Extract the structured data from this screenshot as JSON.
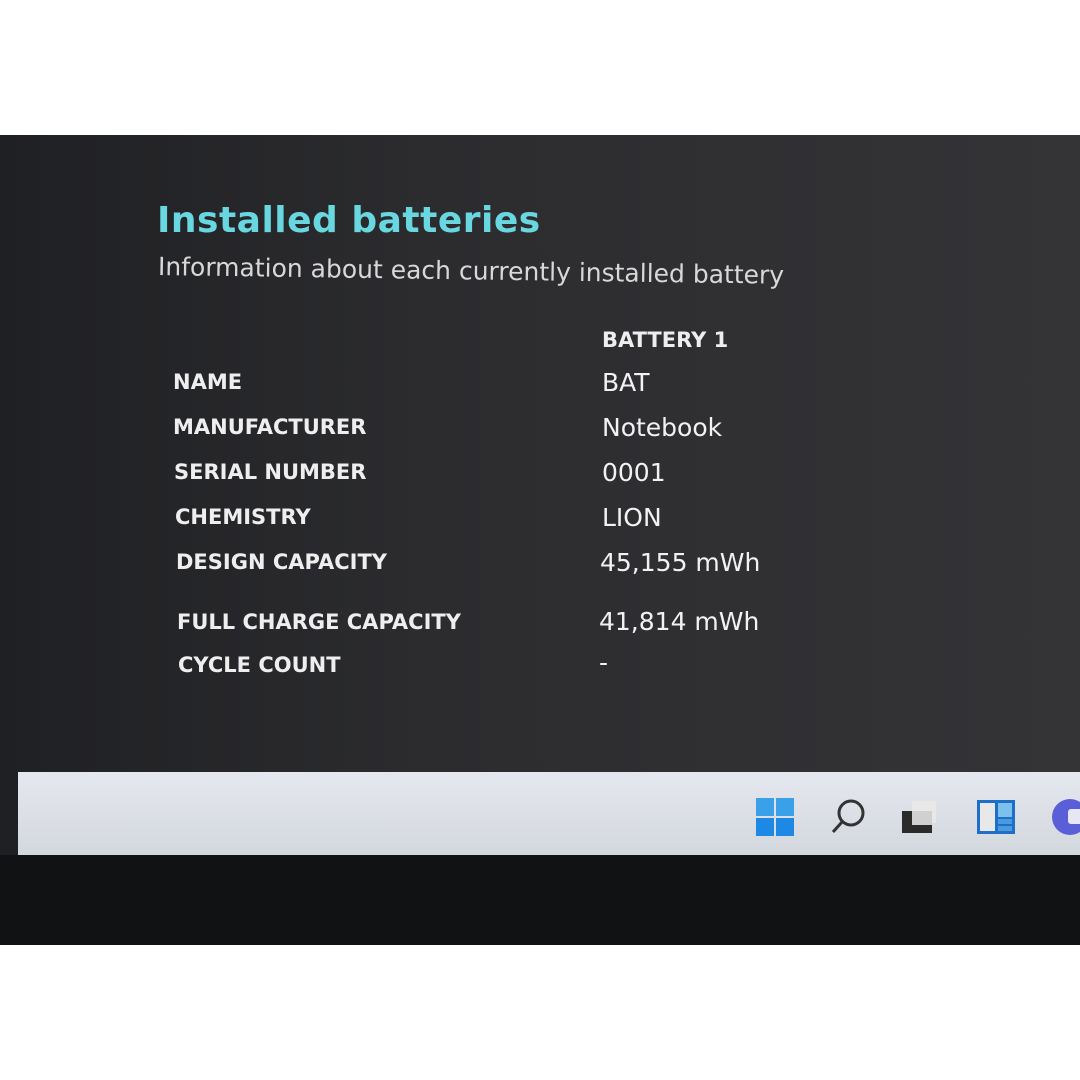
{
  "header": {
    "title": "Installed batteries",
    "subtitle": "Information about each currently installed battery"
  },
  "table": {
    "column_header": "BATTERY 1",
    "rows": [
      {
        "label": "NAME",
        "value": "BAT"
      },
      {
        "label": "MANUFACTURER",
        "value": "Notebook"
      },
      {
        "label": "SERIAL NUMBER",
        "value": "0001"
      },
      {
        "label": "CHEMISTRY",
        "value": "LION"
      },
      {
        "label": "DESIGN CAPACITY",
        "value": "45,155 mWh"
      },
      {
        "label": "FULL CHARGE CAPACITY",
        "value": "41,814 mWh"
      },
      {
        "label": "CYCLE COUNT",
        "value": "-"
      }
    ]
  },
  "taskbar": {
    "icons": [
      "windows-start-icon",
      "search-icon",
      "task-view-icon",
      "widgets-icon",
      "chat-icon"
    ]
  },
  "colors": {
    "title": "#69d7e0",
    "accent": "#1e88e5"
  }
}
